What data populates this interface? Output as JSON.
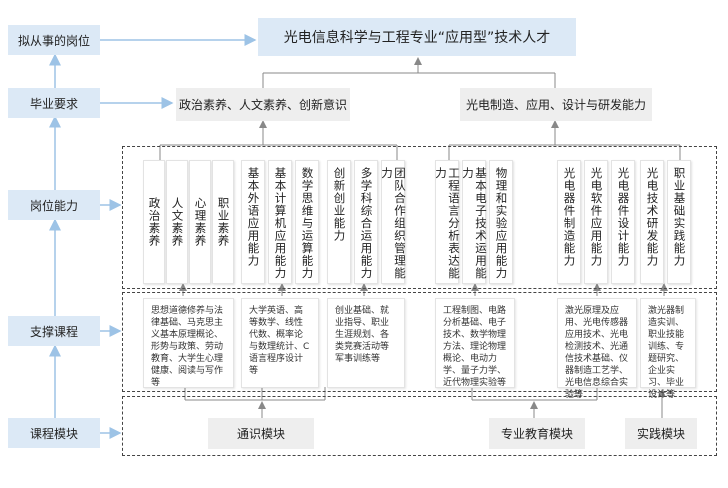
{
  "left_labels": {
    "job": "拟从事的岗位",
    "grad": "毕业要求",
    "ability": "岗位能力",
    "support": "支撑课程",
    "module": "课程模块"
  },
  "title": "光电信息科学与工程专业“应用型”技术人才",
  "requirements": {
    "left": "政治素养、人文素养、创新意识",
    "right": "光电制造、应用、设计与研发能力"
  },
  "abilities": [
    "政治素养",
    "人文素养",
    "心理素养",
    "职业素养",
    "基本外语应用能力",
    "基本计算机应用能力",
    "数学思维与运算能力",
    "创新创业能力",
    "多学科综合运用能力",
    "团队合作组织管理能力",
    "工程语言分析表达能力",
    "基本电子技术运用能力",
    "物理和实验应用能力",
    "光电器件制造能力",
    "光电软件应用能力",
    "光电器件设计能力",
    "光电技术研发能力",
    "职业基础实践能力"
  ],
  "courses": [
    "思想道德修养与法律基础、马克思主义基本原理概论、形势与政策、劳动教育、大学生心理健康、阅读与写作等",
    "大学英语、高等数学、线性代数、概率论与数理统计、C语言程序设计等",
    "创业基础、就业指导、职业生涯规划、各类竞赛活动等军事训练等",
    "工程制图、电路分析基础、电子技术、数学物理方法、理论物理概论、电动力学、量子力学、近代物理实验等",
    "激光原理及应用、光电传感器应用技术、光电检测技术、光通信技术基础、仪器制造工艺学、光电信息综合实验等",
    "激光器制造实训、职业技能训练、专题研究、企业实习、毕业设计等"
  ],
  "modules": {
    "general": "通识模块",
    "professional": "专业教育模块",
    "practice": "实践模块"
  },
  "colors": {
    "accent": "#dce9f6",
    "arrow": "#9dc3e6",
    "grey_box": "#eeeeee"
  }
}
